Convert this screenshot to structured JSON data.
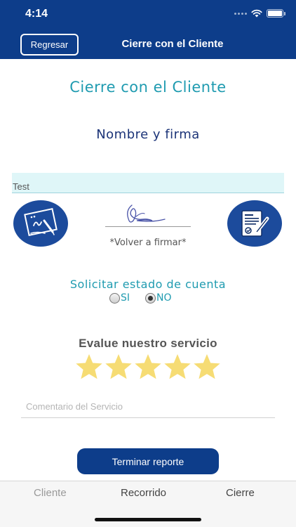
{
  "status_bar": {
    "time": "4:14"
  },
  "header": {
    "back_label": "Regresar",
    "title": "Cierre con el Cliente"
  },
  "content": {
    "section_title": "Cierre con el Cliente",
    "signature_title": "Nombre y firma",
    "name_value": "Test",
    "resign_label": "*Volver a firmar*",
    "account_question": "Solicitar estado de cuenta",
    "radio_options": [
      {
        "label": "SI",
        "checked": false
      },
      {
        "label": "NO",
        "checked": true
      }
    ],
    "rating_title": "Evalue nuestro servicio",
    "rating": {
      "value": 5,
      "max": 5
    },
    "comment_placeholder": "Comentario del Servicio",
    "finish_label": "Terminar reporte"
  },
  "tabs": [
    {
      "label": "Cliente",
      "active": false
    },
    {
      "label": "Recorrido",
      "active": false
    },
    {
      "label": "Cierre",
      "active": true
    }
  ],
  "icons": {
    "sign_pad": "signature-pad-icon",
    "document_sign": "document-sign-icon",
    "star": "star-icon"
  },
  "colors": {
    "primary_blue": "#0d3d8a",
    "icon_blue": "#1c4b9c",
    "teal": "#1f9bb0",
    "navy_text": "#1c3478",
    "star_yellow": "#f6dc74",
    "field_bg": "#dff6f8"
  }
}
